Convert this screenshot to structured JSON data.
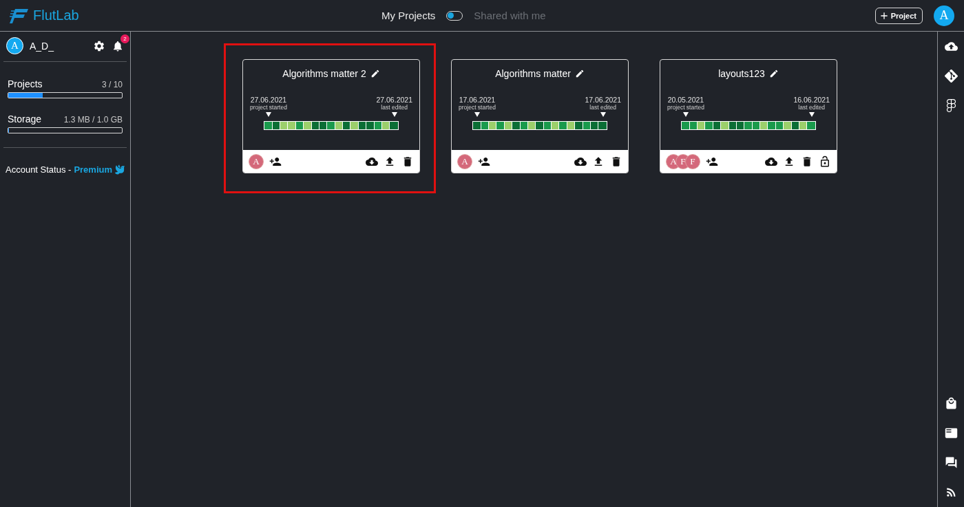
{
  "header": {
    "logo": "FlutLab",
    "views": [
      {
        "label": "My Projects",
        "selected": true
      },
      {
        "label": "Shared with me",
        "selected": false
      }
    ],
    "new_project_button": "Project",
    "avatar": "A"
  },
  "sidebar": {
    "user": {
      "avatar": "A",
      "name": "A_D_"
    },
    "notifications_badge": "2",
    "quotas": [
      {
        "label": "Projects",
        "value": "3 / 10",
        "level": 0.3
      },
      {
        "label": "Storage",
        "value": "1.3 MB / 1.0 GB",
        "level": 0.001
      }
    ],
    "account_status": {
      "label": "Account Status -",
      "value": "Premium"
    }
  },
  "projects": [
    {
      "name": "Algorithms matter 2",
      "highlighted": true,
      "started": "27.06.2021",
      "started_label": "project started",
      "edited": "27.06.2021",
      "edited_label": "last edited",
      "collaborators": [
        "A"
      ],
      "unlocked": false,
      "activity": [
        {
          "color": "#1a9a4c"
        },
        {
          "color": "#0b6e35"
        },
        {
          "color": "#9ccf6b"
        },
        {
          "color": "#9ccf6b"
        },
        {
          "color": "#1a9a4c"
        },
        {
          "color": "#9ccf6b"
        },
        {
          "color": "#0b6e35"
        },
        {
          "color": "#0b6e35"
        },
        {
          "color": "#1a9a4c"
        },
        {
          "color": "#9ccf6b"
        },
        {
          "color": "#0b6e35"
        },
        {
          "color": "#9ccf6b"
        },
        {
          "color": "#0b6e35"
        },
        {
          "color": "#0b6e35"
        },
        {
          "color": "#1a9a4c"
        },
        {
          "color": "#9ccf6b"
        },
        {
          "color": "#0b6e35"
        }
      ]
    },
    {
      "name": "Algorithms matter",
      "highlighted": false,
      "started": "17.06.2021",
      "started_label": "project started",
      "edited": "17.06.2021",
      "edited_label": "last edited",
      "collaborators": [
        "A"
      ],
      "unlocked": false,
      "activity": [
        {
          "color": "#0b6e35"
        },
        {
          "color": "#1a9a4c"
        },
        {
          "color": "#9ccf6b"
        },
        {
          "color": "#1a9a4c"
        },
        {
          "color": "#9ccf6b"
        },
        {
          "color": "#0b6e35"
        },
        {
          "color": "#1a9a4c"
        },
        {
          "color": "#9ccf6b"
        },
        {
          "color": "#0b6e35"
        },
        {
          "color": "#1a9a4c"
        },
        {
          "color": "#9ccf6b"
        },
        {
          "color": "#1a9a4c"
        },
        {
          "color": "#9ccf6b"
        },
        {
          "color": "#0b6e35"
        },
        {
          "color": "#1a9a4c"
        },
        {
          "color": "#0b6e35"
        },
        {
          "color": "#0b6e35"
        }
      ]
    },
    {
      "name": "layouts123",
      "highlighted": false,
      "started": "20.05.2021",
      "started_label": "project started",
      "edited": "16.06.2021",
      "edited_label": "last edited",
      "collaborators": [
        "A",
        "F",
        "F"
      ],
      "unlocked": true,
      "activity": [
        {
          "color": "#1a9a4c"
        },
        {
          "color": "#1a9a4c"
        },
        {
          "color": "#9ccf6b"
        },
        {
          "color": "#1a9a4c"
        },
        {
          "color": "#0b6e35"
        },
        {
          "color": "#9ccf6b"
        },
        {
          "color": "#0b6e35"
        },
        {
          "color": "#0b6e35"
        },
        {
          "color": "#1a9a4c"
        },
        {
          "color": "#1a9a4c"
        },
        {
          "color": "#9ccf6b"
        },
        {
          "color": "#1a9a4c"
        },
        {
          "color": "#1a9a4c"
        },
        {
          "color": "#9ccf6b"
        },
        {
          "color": "#0b6e35"
        },
        {
          "color": "#9ccf6b"
        },
        {
          "color": "#1a9a4c"
        }
      ]
    }
  ]
}
